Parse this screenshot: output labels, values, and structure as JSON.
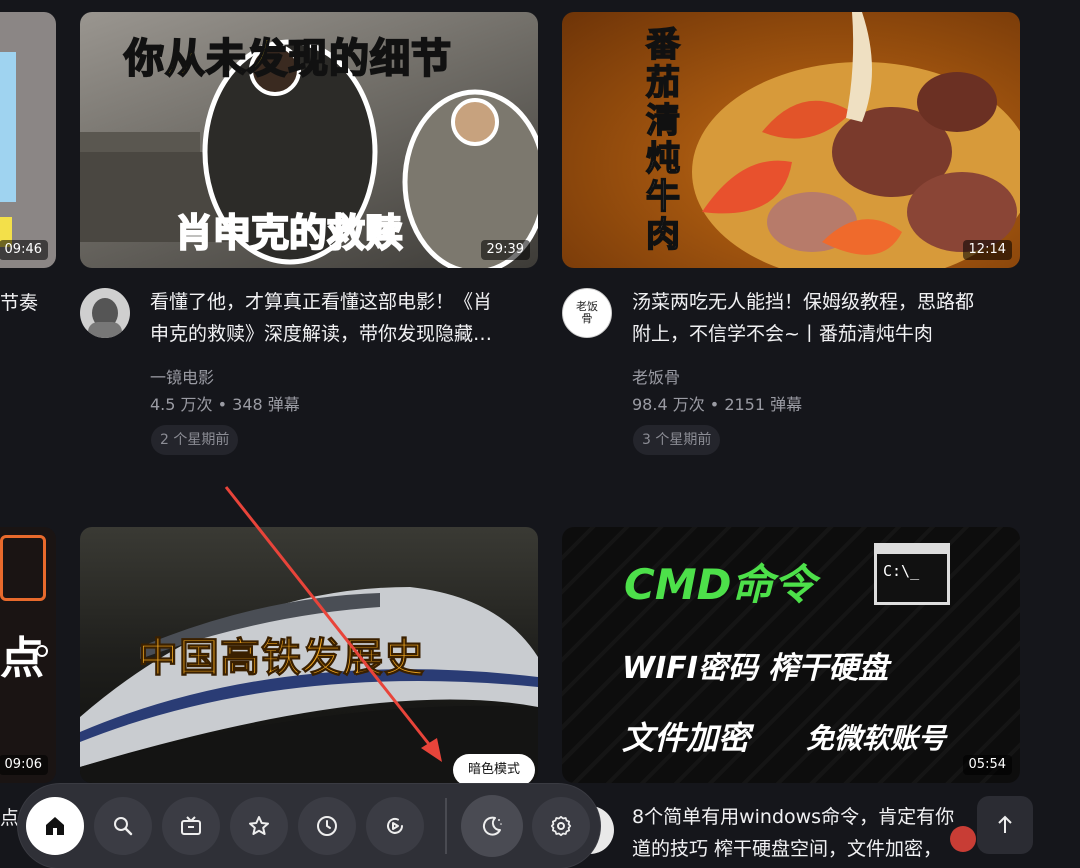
{
  "cards": [
    {
      "thumb_texts": {
        "top": "你从未发现的细节",
        "bottom": "肖申克的救赎"
      },
      "duration": "29:39",
      "title_line1": "看懂了他，才算真正看懂这部电影！《肖",
      "title_line2": "申克的救赎》深度解读，带你发现隐藏…",
      "author": "一镜电影",
      "stats": "4.5 万次 • 348 弹幕",
      "date": "2 个星期前"
    },
    {
      "thumb_texts": {
        "vertical": "番茄清炖牛肉"
      },
      "duration": "12:14",
      "title_line1": "汤菜两吃无人能挡！保姆级教程，思路都",
      "title_line2": "附上，不信学不会~丨番茄清炖牛肉",
      "author": "老饭骨",
      "avatar_text": "老饭骨",
      "stats": "98.4 万次 • 2151 弹幕",
      "date": "3 个星期前"
    },
    {
      "thumb_texts": {
        "main": "中国高铁发展史"
      },
      "duration": ""
    },
    {
      "thumb_texts": {
        "cmd": "CMD命令",
        "prompt": "C:\\_",
        "line2": "WIFI密码 榨干硬盘",
        "line3a": "文件加密",
        "line3b": "免微软账号"
      },
      "duration": "05:54",
      "title_line1": "8个简单有用windows命令，肯定有你",
      "title_line2": "道的技巧 榨干硬盘空间，文件加密，"
    }
  ],
  "left_partial": {
    "duration_top": "09:46",
    "title_fragment": "节奏",
    "duration_bottom": "09:06",
    "thumb_fragment": "点",
    "bottom_fragment": "点"
  },
  "tooltip": "暗色模式",
  "nav": [
    {
      "name": "home-icon"
    },
    {
      "name": "search-icon"
    },
    {
      "name": "tv-icon"
    },
    {
      "name": "star-icon"
    },
    {
      "name": "clock-icon"
    },
    {
      "name": "replay-icon"
    },
    {
      "name": "moon-icon"
    },
    {
      "name": "gear-icon"
    }
  ],
  "colors": {
    "bg": "#15161b",
    "accent_red": "#e8443a",
    "cmd_green": "#4de04a"
  }
}
